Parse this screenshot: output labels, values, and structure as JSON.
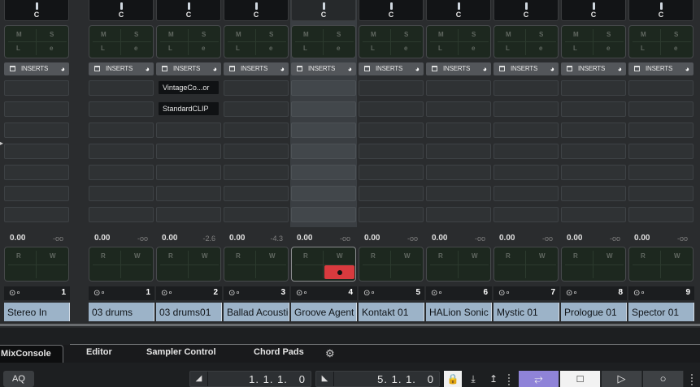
{
  "channels": [
    {
      "pan": "C",
      "insert_label": "INSERTS",
      "plugins": [],
      "volume": "0.00",
      "peak": "-oo",
      "number": "1",
      "name": "Stereo In",
      "selected": false,
      "rec": false
    },
    {
      "pan": "C",
      "insert_label": "INSERTS",
      "plugins": [],
      "volume": "0.00",
      "peak": "-oo",
      "number": "1",
      "name": "03 drums",
      "selected": false,
      "rec": false
    },
    {
      "pan": "C",
      "insert_label": "INSERTS",
      "plugins": [
        "VintageCo...or",
        "StandardCLIP"
      ],
      "volume": "0.00",
      "peak": "-2.6",
      "number": "2",
      "name": "03 drums01",
      "selected": false,
      "rec": false
    },
    {
      "pan": "C",
      "insert_label": "INSERTS",
      "plugins": [],
      "volume": "0.00",
      "peak": "-4.3",
      "number": "3",
      "name": "Ballad Acoustic",
      "selected": false,
      "rec": false
    },
    {
      "pan": "C",
      "insert_label": "INSERTS",
      "plugins": [],
      "volume": "0.00",
      "peak": "-oo",
      "number": "4",
      "name": "Groove Agent",
      "selected": true,
      "rec": true
    },
    {
      "pan": "C",
      "insert_label": "INSERTS",
      "plugins": [],
      "volume": "0.00",
      "peak": "-oo",
      "number": "5",
      "name": "Kontakt 01",
      "selected": false,
      "rec": false
    },
    {
      "pan": "C",
      "insert_label": "INSERTS",
      "plugins": [],
      "volume": "0.00",
      "peak": "-oo",
      "number": "6",
      "name": "HALion Sonic",
      "selected": false,
      "rec": false
    },
    {
      "pan": "C",
      "insert_label": "INSERTS",
      "plugins": [],
      "volume": "0.00",
      "peak": "-oo",
      "number": "7",
      "name": "Mystic 01",
      "selected": false,
      "rec": false
    },
    {
      "pan": "C",
      "insert_label": "INSERTS",
      "plugins": [],
      "volume": "0.00",
      "peak": "-oo",
      "number": "8",
      "name": "Prologue 01",
      "selected": false,
      "rec": false
    },
    {
      "pan": "C",
      "insert_label": "INSERTS",
      "plugins": [],
      "volume": "0.00",
      "peak": "-oo",
      "number": "9",
      "name": "Spector 01",
      "selected": false,
      "rec": false
    }
  ],
  "labels": {
    "mute": "M",
    "solo": "S",
    "listen": "L",
    "edit": "e",
    "read": "R",
    "write": "W"
  },
  "tabs": [
    "MixConsole",
    "Editor",
    "Sampler Control",
    "Chord Pads"
  ],
  "active_tab": "MixConsole",
  "transport": {
    "aq": "AQ",
    "left_locator": "1. 1. 1.   0",
    "right_locator": "5. 1. 1.   0",
    "cycle_on": true
  },
  "colors": {
    "track_name_bg": "#9cb3c8",
    "record": "#d83a3e",
    "cycle": "#8f83d8"
  }
}
